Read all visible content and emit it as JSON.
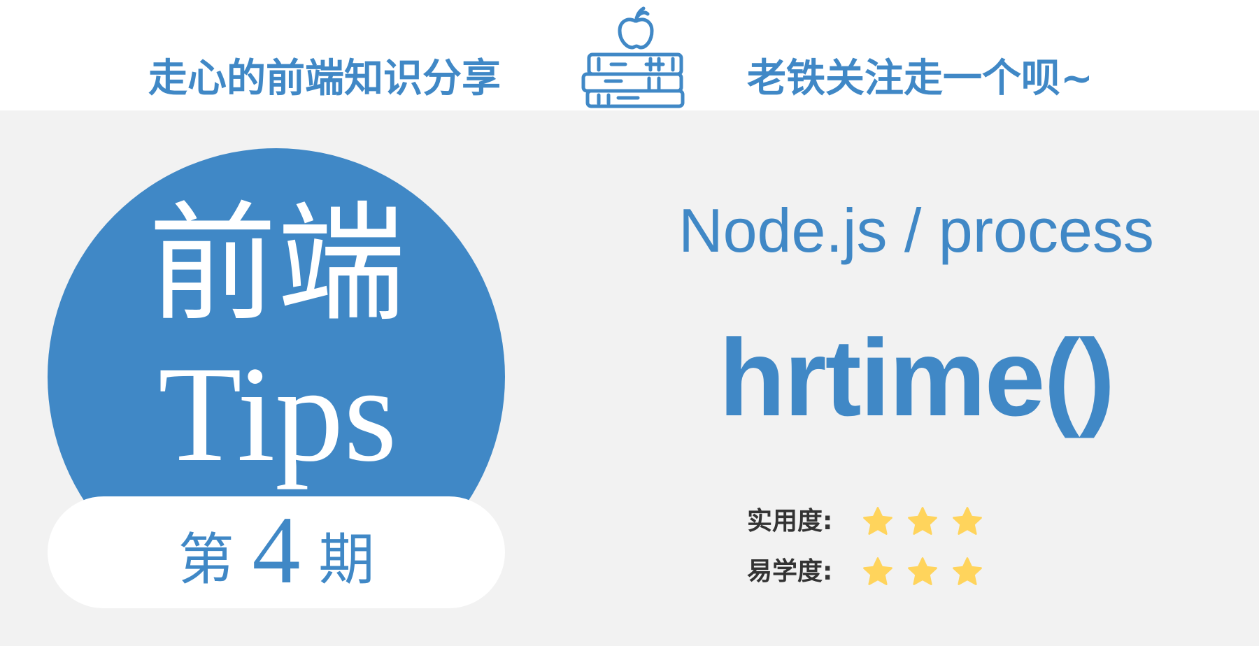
{
  "header": {
    "left_text": "走心的前端知识分享",
    "right_text": "老铁关注走一个呗~",
    "logo_icon": "books-apple-icon"
  },
  "badge": {
    "title_cn": "前端",
    "title_en": "Tips",
    "issue_prefix": "第",
    "issue_number": "4",
    "issue_suffix": "期"
  },
  "topic": {
    "subject": "Node.js / process",
    "method": "hrtime()"
  },
  "ratings": [
    {
      "label": "实用度:",
      "stars": 3
    },
    {
      "label": "易学度:",
      "stars": 3
    }
  ],
  "colors": {
    "brand": "#4088c6",
    "background": "#f2f2f2",
    "header_background": "#ffffff",
    "star": "#ffd45c",
    "label_text": "#333333"
  }
}
